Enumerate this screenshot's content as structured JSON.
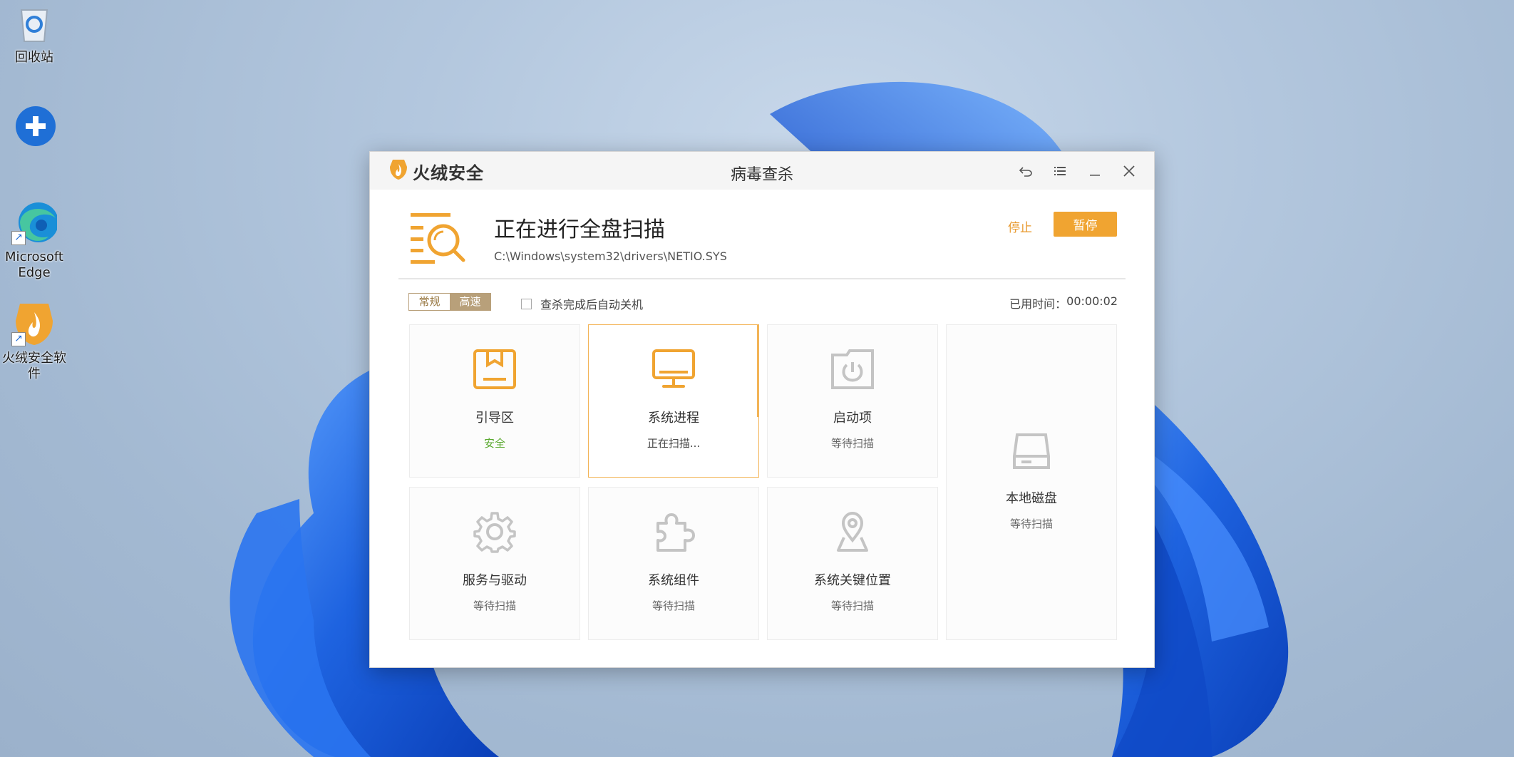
{
  "desktop": {
    "icons": [
      {
        "name": "recycle-bin",
        "label": "回收站"
      },
      {
        "name": "app-blurred",
        "label": ""
      },
      {
        "name": "edge",
        "label": "Microsoft Edge"
      },
      {
        "name": "huorong",
        "label": "火绒安全软件"
      }
    ]
  },
  "window": {
    "brand": "火绒安全",
    "title": "病毒查杀",
    "controls": [
      "back-icon",
      "menu-icon",
      "minimize-icon",
      "close-icon"
    ]
  },
  "scan": {
    "title": "正在进行全盘扫描",
    "current_file": "C:\\Windows\\system32\\drivers\\NETIO.SYS",
    "stop_label": "停止",
    "pause_label": "暂停"
  },
  "options": {
    "mode_normal": "常规",
    "mode_fast": "高速",
    "auto_shutdown_label": "查杀完成后自动关机",
    "elapsed_label": "已用时间：",
    "elapsed_value": "00:00:02"
  },
  "tiles": [
    {
      "name": "引导区",
      "status": "安全",
      "icon": "boot-icon"
    },
    {
      "name": "系统进程",
      "status": "正在扫描...",
      "icon": "monitor-icon"
    },
    {
      "name": "启动项",
      "status": "等待扫描",
      "icon": "startup-icon"
    },
    {
      "name": "本地磁盘",
      "status": "等待扫描",
      "icon": "disk-icon"
    },
    {
      "name": "服务与驱动",
      "status": "等待扫描",
      "icon": "gear-icon"
    },
    {
      "name": "系统组件",
      "status": "等待扫描",
      "icon": "puzzle-icon"
    },
    {
      "name": "系统关键位置",
      "status": "等待扫描",
      "icon": "location-icon"
    }
  ],
  "colors": {
    "accent": "#f0a431",
    "safe": "#5aa92f",
    "inactive_icon": "#c4c4c4",
    "mode_toggle": "#b8a07a"
  }
}
